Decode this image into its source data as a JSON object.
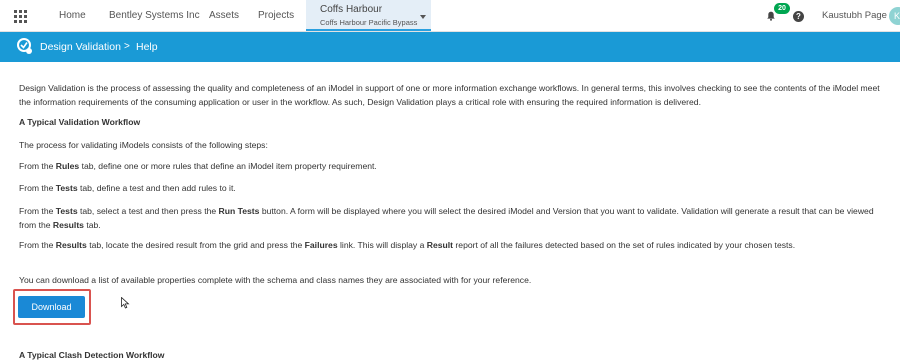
{
  "topnav": {
    "items": [
      {
        "label": "Home"
      },
      {
        "label": "Bentley Systems Inc"
      },
      {
        "label": "Assets"
      },
      {
        "label": "Projects"
      }
    ],
    "project": {
      "title": "Coffs Harbour",
      "subtitle": "Coffs Harbour Pacific Bypass"
    },
    "notification_count": "20",
    "help_symbol": "?",
    "user_name": "Kaustubh Page",
    "avatar_initial": "K"
  },
  "header": {
    "crumb_design": "Design Validation",
    "crumb_separator": ">",
    "crumb_help": "Help"
  },
  "content": {
    "intro": "Design Validation is the process of assessing the quality and completeness of an iModel in support of one or more information exchange workflows. In general terms, this involves checking to see the contents of the iModel meet the information requirements of the consuming application or user in the workflow. As such, Design Validation plays a critical role with ensuring the required information is delivered.",
    "heading_validation": "A Typical Validation Workflow",
    "process_text": "The process for validating iModels consists of the following steps:",
    "step1": {
      "a": "From the ",
      "b": "Rules",
      "c": " tab, define one or more rules that define an iModel item property requirement."
    },
    "step2": {
      "a": "From the ",
      "b": "Tests",
      "c": " tab, define a test and then add rules to it."
    },
    "step3": {
      "a": "From the ",
      "b": "Tests",
      "c": " tab, select a test and then press the ",
      "d": "Run Tests",
      "e": " button. A form will be displayed where you will select the desired iModel and Version that you want to validate. Validation will generate a result that can be viewed from the ",
      "f": "Results",
      "g": " tab."
    },
    "step4": {
      "a": "From the ",
      "b": "Results",
      "c": " tab, locate the desired result from the grid and press the ",
      "d": "Failures",
      "e": " link. This will display a ",
      "f": "Result",
      "g": " report of all the failures detected based on the set of rules indicated by your chosen tests."
    },
    "download_text": "You can download a list of available properties complete with the schema and class names they are associated with for your reference.",
    "download_label": "Download",
    "heading_clash": "A Typical Clash Detection Workflow"
  },
  "colors": {
    "header_blue": "#1a9ad6",
    "button_blue": "#1a89d6",
    "highlight_red": "#d9534f",
    "badge_green": "#00a651"
  }
}
